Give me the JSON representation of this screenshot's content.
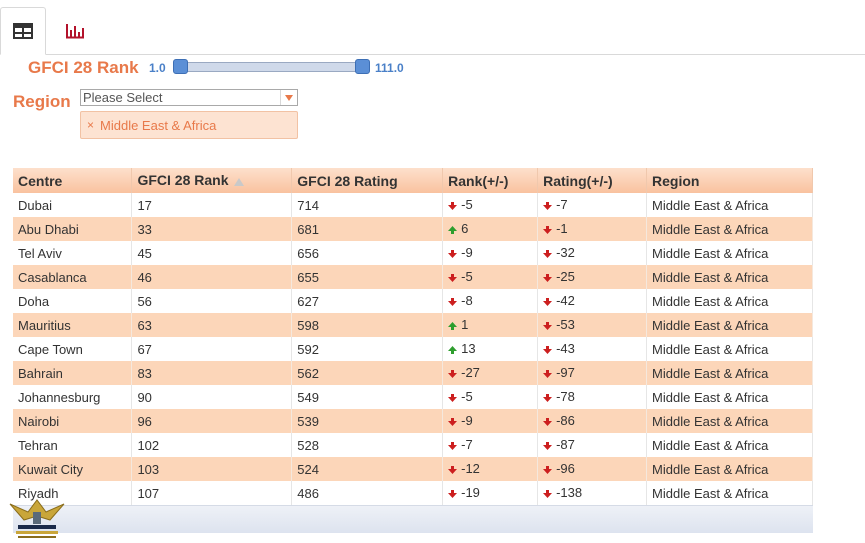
{
  "tabs": [
    {
      "name": "table-view",
      "icon": "table-grid-icon",
      "active": true
    },
    {
      "name": "chart-view",
      "icon": "bar-chart-icon",
      "active": false
    }
  ],
  "filters": {
    "rank_label": "GFCI 28 Rank",
    "slider_min": "1.0",
    "slider_max": "111.0",
    "region_label": "Region",
    "region_placeholder": "Please Select",
    "selected_region": "Middle East & Africa",
    "chip_remove": "×"
  },
  "table": {
    "columns": [
      "Centre",
      "GFCI 28 Rank",
      "GFCI 28 Rating",
      "Rank(+/-)",
      "Rating(+/-)",
      "Region"
    ],
    "rows": [
      {
        "centre": "Dubai",
        "rank": "17",
        "rating": "714",
        "rank_change": "-5",
        "rank_dir": "down",
        "rating_change": "-7",
        "rating_dir": "down",
        "region": "Middle East & Africa"
      },
      {
        "centre": "Abu Dhabi",
        "rank": "33",
        "rating": "681",
        "rank_change": "6",
        "rank_dir": "up",
        "rating_change": "-1",
        "rating_dir": "down",
        "region": "Middle East & Africa"
      },
      {
        "centre": "Tel Aviv",
        "rank": "45",
        "rating": "656",
        "rank_change": "-9",
        "rank_dir": "down",
        "rating_change": "-32",
        "rating_dir": "down",
        "region": "Middle East & Africa"
      },
      {
        "centre": "Casablanca",
        "rank": "46",
        "rating": "655",
        "rank_change": "-5",
        "rank_dir": "down",
        "rating_change": "-25",
        "rating_dir": "down",
        "region": "Middle East & Africa"
      },
      {
        "centre": "Doha",
        "rank": "56",
        "rating": "627",
        "rank_change": "-8",
        "rank_dir": "down",
        "rating_change": "-42",
        "rating_dir": "down",
        "region": "Middle East & Africa"
      },
      {
        "centre": "Mauritius",
        "rank": "63",
        "rating": "598",
        "rank_change": "1",
        "rank_dir": "up",
        "rating_change": "-53",
        "rating_dir": "down",
        "region": "Middle East & Africa"
      },
      {
        "centre": "Cape Town",
        "rank": "67",
        "rating": "592",
        "rank_change": "13",
        "rank_dir": "up",
        "rating_change": "-43",
        "rating_dir": "down",
        "region": "Middle East & Africa"
      },
      {
        "centre": "Bahrain",
        "rank": "83",
        "rating": "562",
        "rank_change": "-27",
        "rank_dir": "down",
        "rating_change": "-97",
        "rating_dir": "down",
        "region": "Middle East & Africa"
      },
      {
        "centre": "Johannesburg",
        "rank": "90",
        "rating": "549",
        "rank_change": "-5",
        "rank_dir": "down",
        "rating_change": "-78",
        "rating_dir": "down",
        "region": "Middle East & Africa"
      },
      {
        "centre": "Nairobi",
        "rank": "96",
        "rating": "539",
        "rank_change": "-9",
        "rank_dir": "down",
        "rating_change": "-86",
        "rating_dir": "down",
        "region": "Middle East & Africa"
      },
      {
        "centre": "Tehran",
        "rank": "102",
        "rating": "528",
        "rank_change": "-7",
        "rank_dir": "down",
        "rating_change": "-87",
        "rating_dir": "down",
        "region": "Middle East & Africa"
      },
      {
        "centre": "Kuwait City",
        "rank": "103",
        "rating": "524",
        "rank_change": "-12",
        "rank_dir": "down",
        "rating_change": "-96",
        "rating_dir": "down",
        "region": "Middle East & Africa"
      },
      {
        "centre": "Riyadh",
        "rank": "107",
        "rating": "486",
        "rank_change": "-19",
        "rank_dir": "down",
        "rating_change": "-138",
        "rating_dir": "down",
        "region": "Middle East & Africa"
      }
    ]
  },
  "colors": {
    "accent": "#e8794a",
    "slider": "#4a80c8",
    "row_alt": "#fcd6b9",
    "arrow_up": "#2e9e2e",
    "arrow_down": "#cc1f1f"
  }
}
